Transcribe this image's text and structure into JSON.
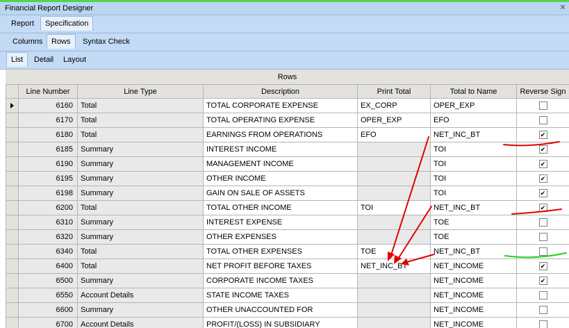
{
  "window": {
    "title": "Financial Report Designer"
  },
  "tabs_level1": [
    {
      "label": "Report"
    },
    {
      "label": "Specification"
    }
  ],
  "tabs_level2": [
    {
      "label": "Columns"
    },
    {
      "label": "Rows"
    },
    {
      "label": "Syntax Check"
    }
  ],
  "tabs_level3": [
    {
      "label": "List"
    },
    {
      "label": "Detail"
    },
    {
      "label": "Layout"
    }
  ],
  "grid": {
    "caption": "Rows",
    "columns": [
      "Line Number",
      "Line Type",
      "Description",
      "Print Total",
      "Total to Name",
      "Reverse Sign"
    ],
    "rows": [
      {
        "line": "6160",
        "type": "Total",
        "desc": "TOTAL  CORPORATE  EXPENSE",
        "print": "EX_CORP",
        "total_to": "OPER_EXP",
        "reverse": false,
        "current": true
      },
      {
        "line": "6170",
        "type": "Total",
        "desc": "TOTAL  OPERATING  EXPENSE",
        "print": "OPER_EXP",
        "total_to": "EFO",
        "reverse": false
      },
      {
        "line": "6180",
        "type": "Total",
        "desc": "EARNINGS  FROM  OPERATIONS",
        "print": "EFO",
        "total_to": "NET_INC_BT",
        "reverse": true
      },
      {
        "line": "6185",
        "type": "Summary",
        "desc": "INTEREST  INCOME",
        "print": "",
        "total_to": "TOI",
        "reverse": true
      },
      {
        "line": "6190",
        "type": "Summary",
        "desc": "MANAGEMENT  INCOME",
        "print": "",
        "total_to": "TOI",
        "reverse": true
      },
      {
        "line": "6195",
        "type": "Summary",
        "desc": "OTHER  INCOME",
        "print": "",
        "total_to": "TOI",
        "reverse": true
      },
      {
        "line": "6198",
        "type": "Summary",
        "desc": "GAIN  ON  SALE  OF  ASSETS",
        "print": "",
        "total_to": "TOI",
        "reverse": true
      },
      {
        "line": "6200",
        "type": "Total",
        "desc": "TOTAL   OTHER  INCOME",
        "print": "TOI",
        "total_to": "NET_INC_BT",
        "reverse": true
      },
      {
        "line": "6310",
        "type": "Summary",
        "desc": "INTEREST  EXPENSE",
        "print": "",
        "total_to": "TOE",
        "reverse": false
      },
      {
        "line": "6320",
        "type": "Summary",
        "desc": "OTHER  EXPENSES",
        "print": "",
        "total_to": "TOE",
        "reverse": false
      },
      {
        "line": "6340",
        "type": "Total",
        "desc": "TOTAL  OTHER  EXPENSES",
        "print": "TOE",
        "total_to": "NET_INC_BT",
        "reverse": false
      },
      {
        "line": "6400",
        "type": "Total",
        "desc": "NET  PROFIT  BEFORE  TAXES",
        "print": "NET_INC_BT",
        "total_to": "NET_INCOME",
        "reverse": true
      },
      {
        "line": "6500",
        "type": "Summary",
        "desc": "CORPORATE  INCOME  TAXES",
        "print": "",
        "total_to": "NET_INCOME",
        "reverse": true
      },
      {
        "line": "6550",
        "type": "Account Details",
        "desc": "STATE  INCOME  TAXES",
        "print": "",
        "total_to": "NET_INCOME",
        "reverse": false
      },
      {
        "line": "6600",
        "type": "Summary",
        "desc": "OTHER  UNACCOUNTED  FOR",
        "print": "",
        "total_to": "NET_INCOME",
        "reverse": false
      },
      {
        "line": "6700",
        "type": "Account Details",
        "desc": "PROFIT/(LOSS)  IN  SUBSIDIARY",
        "print": "",
        "total_to": "NET_INCOME",
        "reverse": false
      }
    ]
  },
  "annotation_colors": {
    "red": "#e00000",
    "green": "#1fd21f"
  },
  "icons": {
    "close": "close-icon",
    "row_pointer": "row-pointer-icon",
    "checkbox": "checkbox-icon"
  }
}
